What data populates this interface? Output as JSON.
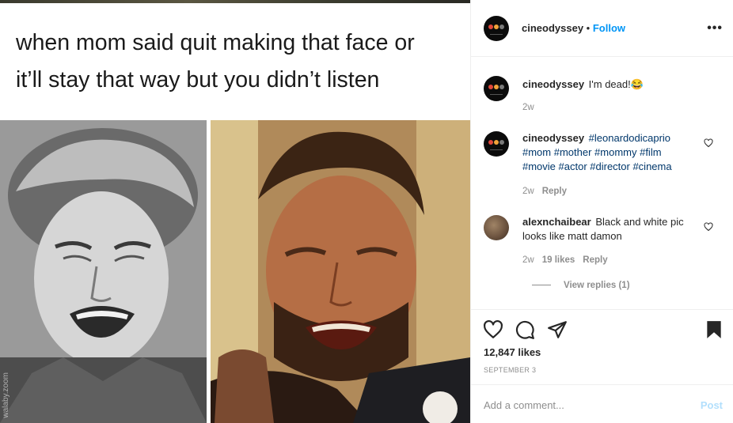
{
  "meme": {
    "caption_line1": "when mom said quit making that face or",
    "caption_line2": "it’ll stay that way but you didn’t listen",
    "watermark": "walaby.zoom"
  },
  "post": {
    "username": "cineodyssey",
    "separator": "•",
    "follow_label": "Follow",
    "more_label": "•••",
    "avatar_dot_colors": [
      "#e0473a",
      "#f2a33a",
      "#7a7a7a"
    ]
  },
  "comments": [
    {
      "username": "cineodyssey",
      "text": "I'm dead!😂",
      "time": "2w"
    },
    {
      "username": "cineodyssey",
      "text_line1_tag": "#leonardodicaprio",
      "text_line2": "#mom #mother #mommy #film",
      "text_line3": "#movie #actor #director #cinema",
      "time": "2w",
      "reply_label": "Reply"
    },
    {
      "username": "alexnchaibear",
      "text_line1": "Black and white pic",
      "text_line2": "looks like matt damon",
      "time": "2w",
      "likes": "19 likes",
      "reply_label": "Reply",
      "view_replies": "View replies (1)"
    }
  ],
  "actions": {
    "like_icon": "heart-outline-icon",
    "comment_icon": "comment-bubble-icon",
    "share_icon": "paper-plane-icon",
    "save_icon": "bookmark-filled-icon",
    "likes_count": "12,847 likes",
    "date": "SEPTEMBER 3"
  },
  "add_comment": {
    "placeholder": "Add a comment...",
    "post_label": "Post"
  },
  "colors": {
    "link_blue": "#0095f6",
    "hashtag": "#00376b",
    "muted": "#8e8e8e",
    "border": "#efefef"
  }
}
